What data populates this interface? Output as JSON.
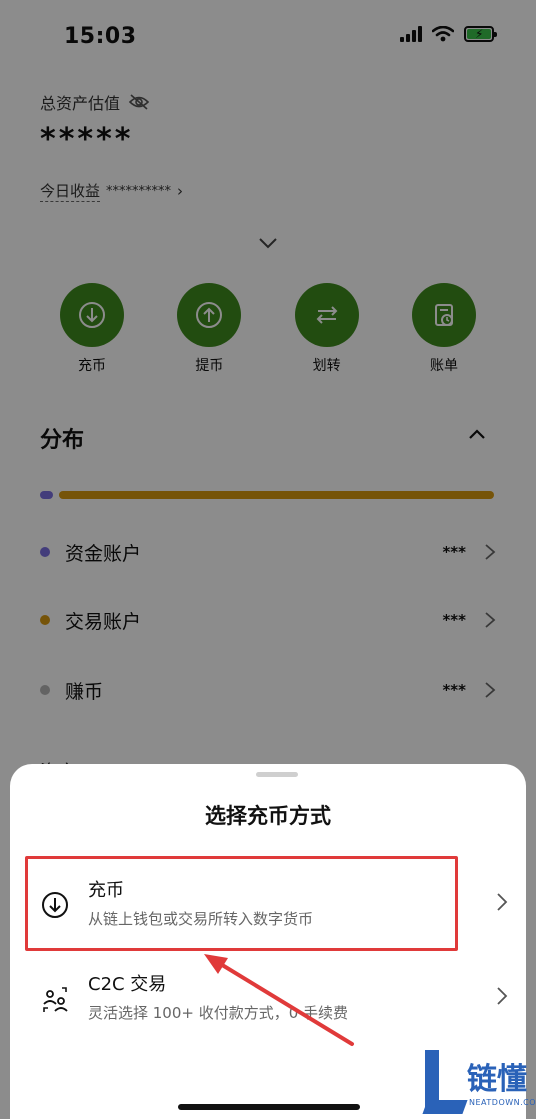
{
  "status_bar": {
    "time": "15:03"
  },
  "assets": {
    "label": "总资产估值",
    "value": "*****",
    "today_label": "今日收益",
    "today_value": "**********",
    "today_arrow": "›"
  },
  "actions": [
    {
      "label": "充币",
      "icon": "deposit-icon"
    },
    {
      "label": "提币",
      "icon": "withdraw-icon"
    },
    {
      "label": "划转",
      "icon": "transfer-icon"
    },
    {
      "label": "账单",
      "icon": "bill-icon"
    }
  ],
  "distribution": {
    "title": "分布",
    "accounts": [
      {
        "name": "资金账户",
        "amount": "***",
        "color": "#7b6fe0"
      },
      {
        "name": "交易账户",
        "amount": "***",
        "color": "#d89a12"
      },
      {
        "name": "赚币",
        "amount": "***",
        "color": "#b4b4b4"
      }
    ],
    "bar_fractions": [
      0.03,
      0.97
    ],
    "peek_text": "资产"
  },
  "sheet": {
    "title": "选择充币方式",
    "options": [
      {
        "title": "充币",
        "desc": "从链上钱包或交易所转入数字货币",
        "icon": "deposit-icon"
      },
      {
        "title": "C2C 交易",
        "desc": "灵活选择 100+ 收付款方式，0 手续费",
        "icon": "c2c-icon"
      }
    ]
  },
  "watermark": {
    "brand": "链懂",
    "sub": "NEATDOWN.COM"
  },
  "colors": {
    "accent_green": "#3f8a1e",
    "highlight_red": "#e03a3a",
    "watermark_blue": "#2a62b8"
  }
}
